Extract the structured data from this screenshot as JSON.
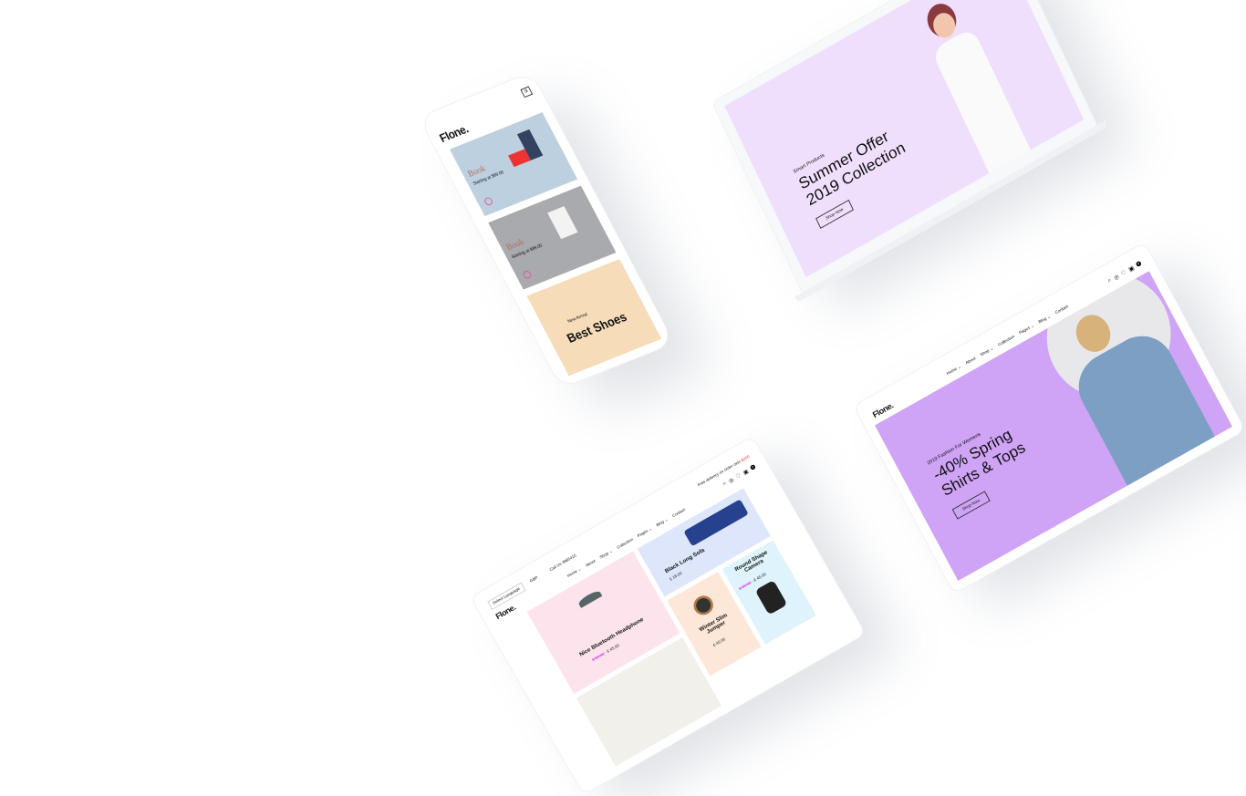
{
  "phone": {
    "logo": "Flone.",
    "menu_icon": "hamburger-icon",
    "slides": [
      {
        "title": "Book",
        "subtitle": "Starting at $99.00",
        "color": "#bcd0e0"
      },
      {
        "title": "Book",
        "subtitle": "Starting at $99.00",
        "color": "#a9aaae"
      },
      {
        "title": "New Arrival",
        "subtitle": "Best Shoes",
        "color": "#f6dcb8"
      }
    ]
  },
  "laptop": {
    "kicker": "Smart Products",
    "headline_1": "Summer Offer",
    "headline_2": "2019 Collection",
    "button": "Shop Now",
    "bg": "#efdffc"
  },
  "tablet_right": {
    "logo": "Flone.",
    "nav": [
      "Home ⌄",
      "About",
      "Shop ⌄",
      "Collection",
      "Pages ⌄",
      "Blog ⌄",
      "Contact"
    ],
    "cart_count": "0",
    "kicker": "2019 Fashion For Womens",
    "headline_1": "-40% Spring",
    "headline_2": "Shirts & Tops",
    "button": "Shop Now",
    "bg": "#cfa3f5"
  },
  "tablet_bottom": {
    "logo": "Flone.",
    "language": "Select Language",
    "currency": "GBP",
    "phone": "Call Us 3965410",
    "delivery": "Free delivery on order over",
    "delivery_amount": "$200",
    "nav": [
      "Home ⌄",
      "About",
      "Shop ⌄",
      "Collection",
      "Pages ⌄",
      "Blog ⌄",
      "Contact"
    ],
    "cart_count": "0",
    "products": [
      {
        "name": "Nice Bluetooth Headphone",
        "old_price": "£ 60.00",
        "price": "£ 45.00",
        "bg": "#fde4ec"
      },
      {
        "name": "Black Long Sofa",
        "price": "£ 18.00",
        "bg": "#dde6fb"
      },
      {
        "name": "Winter Slim Jumper",
        "price": "£ 45.00",
        "bg": "#fde7d8"
      },
      {
        "name": "Round Shape Camera",
        "old_price": "£ 60.00",
        "price": "£ 45.00",
        "bg": "#def3fb"
      }
    ]
  }
}
